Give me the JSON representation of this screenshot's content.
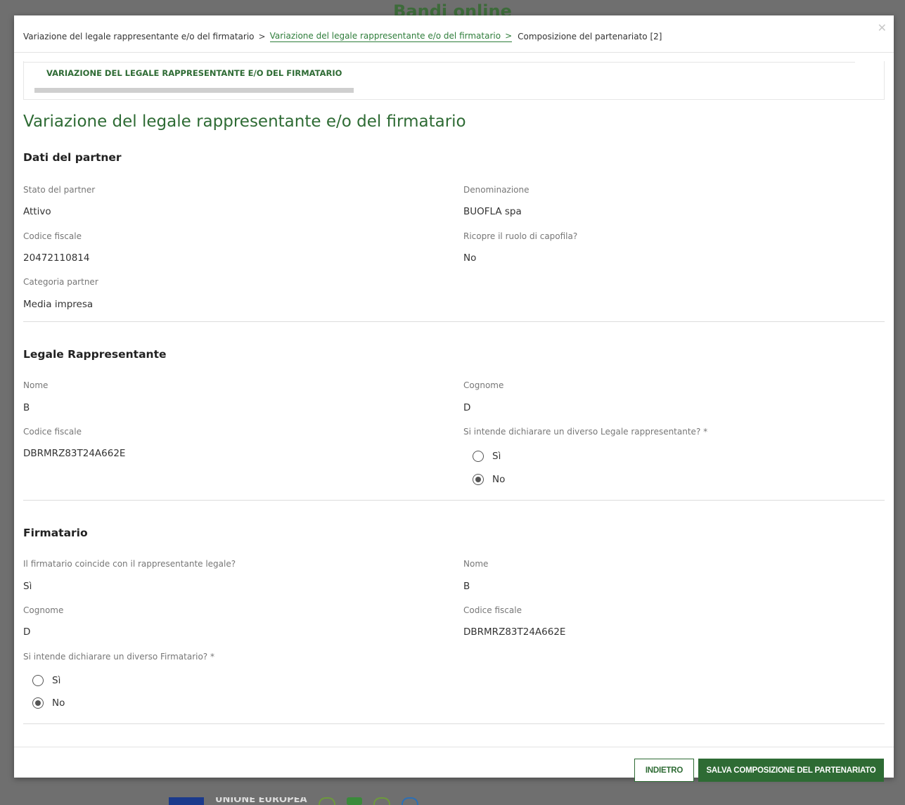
{
  "background": {
    "site_title": "Bandi online",
    "footer_eu_label": "UNIONE EUROPEA"
  },
  "breadcrumb": {
    "items": [
      "Variazione del legale rappresentante e/o del firmatario",
      "Variazione del legale rappresentante e/o del firmatario",
      "Composizione del partenariato [2]"
    ],
    "separator": ">"
  },
  "close_icon": "close-icon",
  "step": {
    "label": "VARIAZIONE DEL LEGALE RAPPRESENTANTE E/O DEL FIRMATARIO"
  },
  "page_title": "Variazione del legale rappresentante e/o del firmatario",
  "partner": {
    "title": "Dati del partner",
    "stato_label": "Stato del partner",
    "stato_value": "Attivo",
    "denominazione_label": "Denominazione",
    "denominazione_value": "BUOFLA spa",
    "codice_fiscale_label": "Codice fiscale",
    "codice_fiscale_value": "20472110814",
    "capofila_label": "Ricopre il ruolo di capofila?",
    "capofila_value": "No",
    "categoria_label": "Categoria partner",
    "categoria_value": "Media impresa"
  },
  "legale": {
    "title": "Legale Rappresentante",
    "nome_label": "Nome",
    "nome_value": "B",
    "cognome_label": "Cognome",
    "cognome_value": "D",
    "codice_fiscale_label": "Codice fiscale",
    "codice_fiscale_value": "DBRMRZ83T24A662E",
    "diverso_label": "Si intende dichiarare un diverso Legale rappresentante? *",
    "option_si": "Sì",
    "option_no": "No",
    "selected": "No"
  },
  "firmatario": {
    "title": "Firmatario",
    "coincide_label": "Il firmatario coincide con il rappresentante legale?",
    "coincide_value": "Sì",
    "nome_label": "Nome",
    "nome_value": "B",
    "cognome_label": "Cognome",
    "cognome_value": "D",
    "codice_fiscale_label": "Codice fiscale",
    "codice_fiscale_value": "DBRMRZ83T24A662E",
    "diverso_label": "Si intende dichiarare un diverso Firmatario? *",
    "option_si": "Sì",
    "option_no": "No",
    "selected": "No"
  },
  "footer": {
    "back_label": "INDIETRO",
    "save_label": "SALVA COMPOSIZIONE DEL PARTENARIATO"
  },
  "colors": {
    "accent": "#2e6b34",
    "overlay": "#6f6f6f"
  }
}
